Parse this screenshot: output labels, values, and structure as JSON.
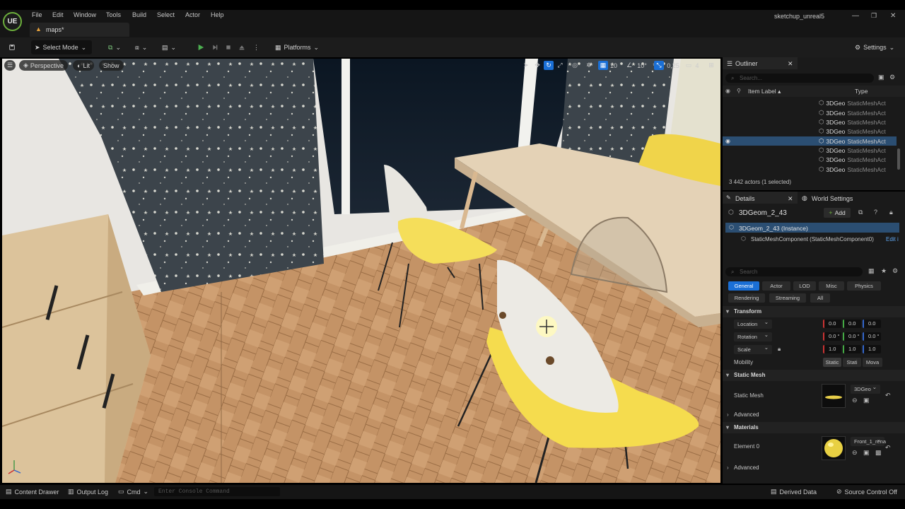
{
  "menu": [
    "File",
    "Edit",
    "Window",
    "Tools",
    "Build",
    "Select",
    "Actor",
    "Help"
  ],
  "logo_text": "UE",
  "tab": {
    "label": "maps*"
  },
  "project_name": "sketchup_unreal5",
  "toolbar": {
    "mode_label": "Select Mode",
    "platforms_label": "Platforms",
    "settings_label": "Settings"
  },
  "viewport": {
    "perspective": "Perspective",
    "lit": "Lit",
    "show": "Show",
    "grid_snap": "10",
    "rot_snap": "10°",
    "scale_snap": "0,25",
    "camera_speed": "4"
  },
  "outliner": {
    "title": "Outliner",
    "search_placeholder": "Search...",
    "col_label": "Item Label",
    "col_type": "Type",
    "rows": [
      {
        "label": "3DGeo",
        "type": "StaticMeshAct"
      },
      {
        "label": "3DGeo",
        "type": "StaticMeshAct"
      },
      {
        "label": "3DGeo",
        "type": "StaticMeshAct"
      },
      {
        "label": "3DGeo",
        "type": "StaticMeshAct"
      },
      {
        "label": "3DGeo",
        "type": "StaticMeshAct"
      },
      {
        "label": "3DGeo",
        "type": "StaticMeshAct"
      },
      {
        "label": "3DGeo",
        "type": "StaticMeshAct"
      },
      {
        "label": "3DGeo",
        "type": "StaticMeshAct"
      }
    ],
    "selected_index": 4,
    "status": "3 442 actors (1 selected)"
  },
  "details": {
    "tab_details": "Details",
    "tab_world": "World Settings",
    "actor_name": "3DGeom_2_43",
    "add_label": "Add",
    "instance_label": "3DGeom_2_43 (Instance)",
    "component_label": "StaticMeshComponent (StaticMeshComponent0)",
    "edit_label": "Edit i",
    "search_placeholder": "Search",
    "filters1": [
      "General",
      "Actor",
      "LOD",
      "Misc",
      "Physics"
    ],
    "filters2": [
      "Rendering",
      "Streaming",
      "All"
    ],
    "transform": {
      "title": "Transform",
      "location_label": "Location",
      "rotation_label": "Rotation",
      "scale_label": "Scale",
      "mobility_label": "Mobility",
      "location": [
        "0.0",
        "0.0",
        "0.0"
      ],
      "rotation": [
        "0.0 °",
        "0.0 °",
        "0.0 °"
      ],
      "scale": [
        "1.0",
        "1.0",
        "1.0"
      ],
      "mobility": [
        "Static",
        "Stati",
        "Mova"
      ]
    },
    "static_mesh": {
      "title": "Static Mesh",
      "label": "Static Mesh",
      "value": "3DGeo"
    },
    "advanced1": "Advanced",
    "materials": {
      "title": "Materials",
      "label": "Element 0",
      "value": "Front_1_rena"
    },
    "advanced2": "Advanced"
  },
  "statusbar": {
    "content_drawer": "Content Drawer",
    "output_log": "Output Log",
    "cmd": "Cmd",
    "console_placeholder": "Enter Console Command",
    "derived_data": "Derived Data",
    "source_control": "Source Control Off"
  },
  "colors": {
    "accent": "#1a6fd6",
    "selected_row": "#2b4e72",
    "play": "#4caf50"
  }
}
